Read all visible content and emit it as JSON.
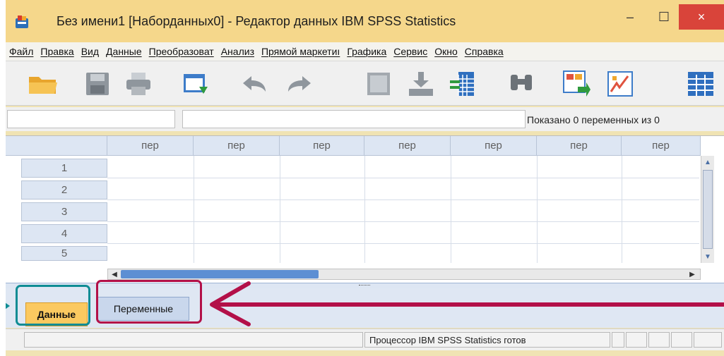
{
  "window": {
    "title": "Без имени1 [Наборданных0] - Редактор данных IBM SPSS Statistics",
    "min_glyph": "–",
    "max_glyph": "☐",
    "close_glyph": "×"
  },
  "menu": [
    "Файл",
    "Правка",
    "Вид",
    "Данные",
    "Преобразоват",
    "Анализ",
    "Прямой маркетиı",
    "Графика",
    "Сервис",
    "Окно",
    "Справка"
  ],
  "toolbar": {
    "icons": [
      "open-folder-icon",
      "save-icon",
      "print-icon",
      "dialog-recall-icon",
      "undo-icon",
      "redo-icon",
      "goto-case-icon",
      "insert-case-icon",
      "insert-variable-icon",
      "find-icon",
      "split-file-icon",
      "weight-cases-icon",
      "value-labels-icon"
    ]
  },
  "infobar": {
    "cell_reference": "",
    "cell_value": "",
    "variables_shown": "Показано 0 переменных из 0"
  },
  "grid": {
    "columns": [
      "пер",
      "пер",
      "пер",
      "пер",
      "пер",
      "пер",
      "пер"
    ],
    "rows": [
      "1",
      "2",
      "3",
      "4",
      "5"
    ]
  },
  "tabs": {
    "data": "Данные",
    "variables": "Переменные"
  },
  "status": {
    "processor": "Процессор IBM SPSS Statistics  готов"
  },
  "colors": {
    "title_bar": "#f5d78b",
    "close_button": "#d9443a",
    "active_tab": "#fbc960",
    "highlight_teal": "#0f8c94",
    "highlight_crimson": "#b31048"
  }
}
